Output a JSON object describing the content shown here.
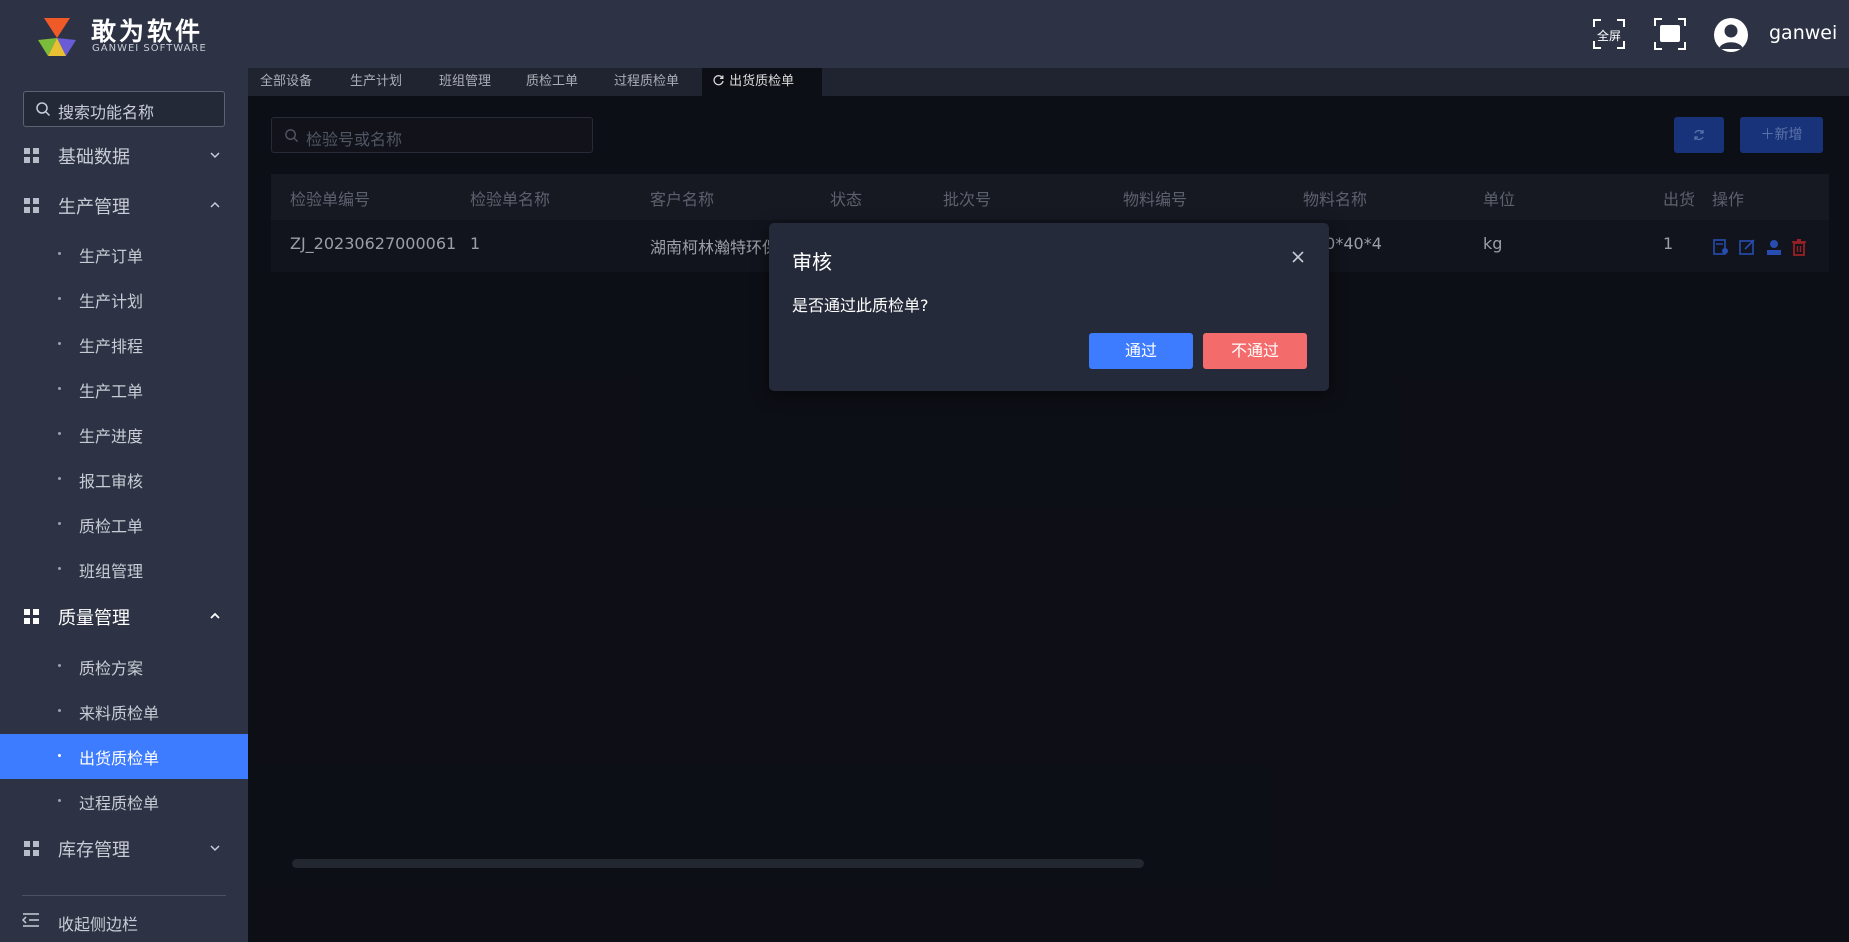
{
  "header": {
    "brand_cn": "敢为软件",
    "brand_en": "GANWEI SOFTWARE",
    "fullscreen_label": "全屏",
    "username": "ganwei"
  },
  "sidebar": {
    "search_placeholder": "搜索功能名称",
    "groups": [
      {
        "label": "基础数据",
        "expanded": false
      },
      {
        "label": "生产管理",
        "expanded": true,
        "items": [
          "生产订单",
          "生产计划",
          "生产排程",
          "生产工单",
          "生产进度",
          "报工审核",
          "质检工单",
          "班组管理"
        ]
      },
      {
        "label": "质量管理",
        "expanded": true,
        "items": [
          "质检方案",
          "来料质检单",
          "出货质检单",
          "过程质检单"
        ]
      },
      {
        "label": "库存管理",
        "expanded": false
      }
    ],
    "selected_item": "出货质检单",
    "collapse_label": "收起侧边栏"
  },
  "tabs": [
    {
      "label": "全部设备"
    },
    {
      "label": "生产计划"
    },
    {
      "label": "班组管理"
    },
    {
      "label": "质检工单"
    },
    {
      "label": "过程质检单"
    },
    {
      "label": "出货质检单",
      "active": true
    }
  ],
  "main": {
    "search_placeholder": "检验号或名称",
    "add_label": "新增",
    "columns": [
      "检验单编号",
      "检验单名称",
      "客户名称",
      "状态",
      "批次号",
      "物料编号",
      "物料名称",
      "单位",
      "出货",
      "操作"
    ],
    "rows": [
      {
        "code": "ZJ_20230627000061",
        "name": "1",
        "customer": "湖南柯林瀚特环保",
        "material_name": "40*40*4",
        "unit": "kg",
        "qty": "1"
      }
    ]
  },
  "modal": {
    "title": "审核",
    "message": "是否通过此质检单?",
    "pass_label": "通过",
    "reject_label": "不通过"
  },
  "colors": {
    "accent": "#3d7bff",
    "danger": "#f46b6b",
    "header_bg": "#2d3344",
    "content_bg": "#10121a"
  }
}
